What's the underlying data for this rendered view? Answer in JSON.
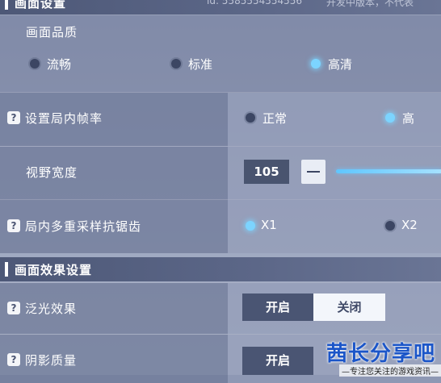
{
  "graphics_section": {
    "title": "画面设置",
    "id_text": "id: 5585554554556",
    "version_text": "开发中版本，不代表"
  },
  "quality": {
    "label": "画面品质",
    "options": [
      "流畅",
      "标准",
      "高清"
    ],
    "selected": "高清"
  },
  "framerate": {
    "help": "?",
    "label": "设置局内帧率",
    "options": [
      "正常",
      "高"
    ],
    "selected": "高"
  },
  "fov": {
    "label": "视野宽度",
    "value": "105",
    "minus_label": "−"
  },
  "msaa": {
    "help": "?",
    "label": "局内多重采样抗锯齿",
    "options": [
      "X1",
      "X2"
    ],
    "selected": "X1"
  },
  "effects_section": {
    "title": "画面效果设置"
  },
  "bloom": {
    "help": "?",
    "label": "泛光效果",
    "on_label": "开启",
    "off_label": "关闭",
    "selected": "关闭"
  },
  "shadow": {
    "help": "?",
    "label": "阴影质量",
    "on_label": "开启",
    "selected": "开启"
  },
  "watermark": {
    "main": "茜长分享吧",
    "sub": "—专注您关注的游戏资讯—"
  },
  "colors": {
    "accent": "#7cd4ff",
    "selected_segment": "#f3f6fb",
    "unselected_segment": "#4a5573"
  }
}
